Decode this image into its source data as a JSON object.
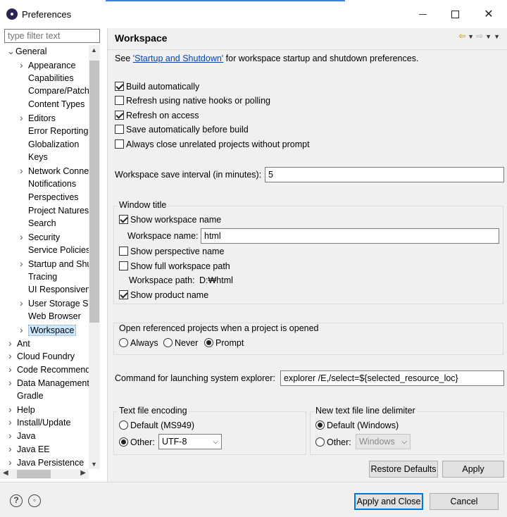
{
  "window": {
    "title": "Preferences"
  },
  "filter": {
    "placeholder": "type filter text"
  },
  "tree": {
    "general": "General",
    "general_children": [
      {
        "label": "Appearance",
        "expandable": true
      },
      {
        "label": "Capabilities",
        "expandable": false
      },
      {
        "label": "Compare/Patch",
        "expandable": false
      },
      {
        "label": "Content Types",
        "expandable": false
      },
      {
        "label": "Editors",
        "expandable": true
      },
      {
        "label": "Error Reporting",
        "expandable": false
      },
      {
        "label": "Globalization",
        "expandable": false
      },
      {
        "label": "Keys",
        "expandable": false
      },
      {
        "label": "Network Connections",
        "expandable": true
      },
      {
        "label": "Notifications",
        "expandable": false
      },
      {
        "label": "Perspectives",
        "expandable": false
      },
      {
        "label": "Project Natures",
        "expandable": false
      },
      {
        "label": "Search",
        "expandable": false
      },
      {
        "label": "Security",
        "expandable": true
      },
      {
        "label": "Service Policies",
        "expandable": false
      },
      {
        "label": "Startup and Shutdown",
        "expandable": true
      },
      {
        "label": "Tracing",
        "expandable": false
      },
      {
        "label": "UI Responsiveness",
        "expandable": false
      },
      {
        "label": "User Storage Service",
        "expandable": true
      },
      {
        "label": "Web Browser",
        "expandable": false
      },
      {
        "label": "Workspace",
        "expandable": true,
        "selected": true
      }
    ],
    "top_level": [
      "Ant",
      "Cloud Foundry",
      "Code Recommenders",
      "Data Management",
      "Gradle",
      "Help",
      "Install/Update",
      "Java",
      "Java EE",
      "Java Persistence"
    ],
    "top_level_expandable": [
      true,
      true,
      true,
      true,
      false,
      true,
      true,
      true,
      true,
      true
    ]
  },
  "page": {
    "title": "Workspace",
    "see_prefix": "See ",
    "see_link": "'Startup and Shutdown'",
    "see_suffix": " for workspace startup and shutdown preferences.",
    "options": [
      {
        "label": "Build automatically",
        "checked": true
      },
      {
        "label": "Refresh using native hooks or polling",
        "checked": false
      },
      {
        "label": "Refresh on access",
        "checked": true
      },
      {
        "label": "Save automatically before build",
        "checked": false
      },
      {
        "label": "Always close unrelated projects without prompt",
        "checked": false
      }
    ],
    "save_interval_label": "Workspace save interval (in minutes):",
    "save_interval_value": "5",
    "window_title": {
      "legend": "Window title",
      "show_workspace_name": "Show workspace name",
      "workspace_name_label": "Workspace name:",
      "workspace_name_value": "html",
      "show_perspective_name": "Show perspective name",
      "show_full_path": "Show full workspace path",
      "workspace_path_label": "Workspace path:",
      "workspace_path_value": "D:₩html",
      "show_product_name": "Show product name"
    },
    "open_ref": {
      "label": "Open referenced projects when a project is opened",
      "options": [
        "Always",
        "Never",
        "Prompt"
      ],
      "selected": "Prompt"
    },
    "explorer_label": "Command for launching system explorer:",
    "explorer_value": "explorer /E,/select=${selected_resource_loc}",
    "encoding": {
      "legend": "Text file encoding",
      "default_label": "Default (MS949)",
      "other_label": "Other:",
      "other_value": "UTF-8",
      "selected": "Other"
    },
    "delimiter": {
      "legend": "New text file line delimiter",
      "default_label": "Default (Windows)",
      "other_label": "Other:",
      "other_value": "Windows",
      "selected": "Default"
    },
    "restore_defaults": "Restore Defaults",
    "apply": "Apply"
  },
  "footer": {
    "apply_and_close": "Apply and Close",
    "cancel": "Cancel"
  },
  "colors": {
    "selection": "#cce8ff",
    "link": "#0645ad",
    "default_button_border": "#0078d7"
  }
}
